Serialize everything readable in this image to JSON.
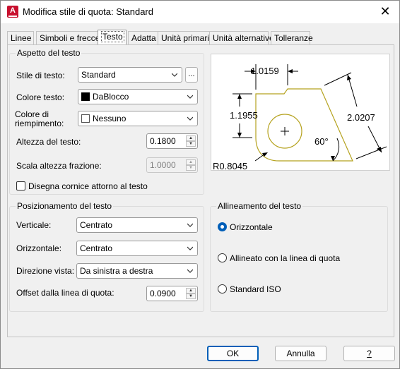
{
  "window": {
    "title": "Modifica stile di quota: Standard",
    "app_icon_letter": "A",
    "close_symbol": "✕"
  },
  "tabs": [
    {
      "label": "Linee"
    },
    {
      "label": "Simboli e frecce"
    },
    {
      "label": "Testo"
    },
    {
      "label": "Adatta"
    },
    {
      "label": "Unità primarie"
    },
    {
      "label": "Unità alternative"
    },
    {
      "label": "Tolleranze"
    }
  ],
  "active_tab": "Testo",
  "text_appearance": {
    "title": "Aspetto del testo",
    "text_style_label": "Stile di testo:",
    "text_style_value": "Standard",
    "browse_label": "...",
    "text_color_label": "Colore testo:",
    "text_color_value": "DaBlocco",
    "text_color_swatch": "#000000",
    "fill_color_label_1": "Colore di",
    "fill_color_label_2": "riempimento:",
    "fill_color_value": "Nessuno",
    "fill_color_swatch": "#ffffff",
    "text_height_label": "Altezza del testo:",
    "text_height_value": "0.1800",
    "fraction_scale_label": "Scala altezza frazione:",
    "fraction_scale_value": "1.0000",
    "draw_frame_label": "Disegna cornice attorno al testo",
    "draw_frame_checked": false
  },
  "text_placement": {
    "title": "Posizionamento del testo",
    "vertical_label": "Verticale:",
    "vertical_value": "Centrato",
    "horizontal_label": "Orizzontale:",
    "horizontal_value": "Centrato",
    "view_direction_label": "Direzione vista:",
    "view_direction_value": "Da sinistra a destra",
    "offset_label": "Offset dalla linea di quota:",
    "offset_value": "0.0900"
  },
  "text_alignment": {
    "title": "Allineamento del testo",
    "options": [
      {
        "label": "Orizzontale",
        "checked": true
      },
      {
        "label": "Allineato con la linea di quota",
        "checked": false
      },
      {
        "label": "Standard ISO",
        "checked": false
      }
    ]
  },
  "preview": {
    "dim_top": "1.0159",
    "dim_left": "1.1955",
    "dim_right": "2.0207",
    "dim_angle": "60°",
    "dim_radius": "R0.8045"
  },
  "buttons": {
    "ok": "OK",
    "cancel": "Annulla",
    "help": "?"
  },
  "colors": {
    "accent": "#005fb8",
    "preview_geometry": "#b5a21e",
    "app_icon": "#c8102e"
  }
}
